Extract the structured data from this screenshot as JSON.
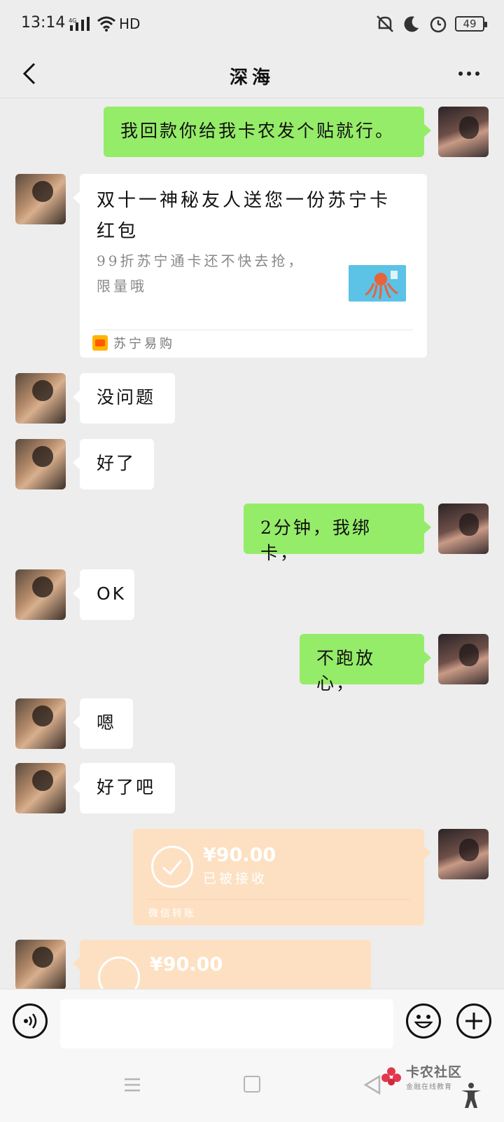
{
  "status_bar": {
    "time": "13:14",
    "network": "4G",
    "hd": "HD",
    "battery": "49"
  },
  "header": {
    "title": "深海"
  },
  "messages": [
    {
      "side": "right",
      "type": "text",
      "text": "我回款你给我卡农发个贴就行。"
    },
    {
      "side": "left",
      "type": "link",
      "title": "双十一神秘友人送您一份苏宁卡红包",
      "desc": "99折苏宁通卡还不快去抢，限量哦",
      "source": "苏宁易购"
    },
    {
      "side": "left",
      "type": "text",
      "text": "没问题"
    },
    {
      "side": "left",
      "type": "text",
      "text": "好了"
    },
    {
      "side": "right",
      "type": "text",
      "text": "2分钟，我绑卡，"
    },
    {
      "side": "left",
      "type": "text",
      "text": "OK"
    },
    {
      "side": "right",
      "type": "text",
      "text": "不跑放心，"
    },
    {
      "side": "left",
      "type": "text",
      "text": "嗯"
    },
    {
      "side": "left",
      "type": "text",
      "text": "好了吧"
    },
    {
      "side": "right",
      "type": "transfer",
      "amount": "¥90.00",
      "status": "已被接收",
      "footer": "微信转账"
    },
    {
      "side": "left",
      "type": "transfer",
      "amount": "¥90.00"
    }
  ],
  "input": {
    "placeholder": ""
  },
  "watermark": {
    "name": "卡农社区",
    "sub": "金融在线教育"
  },
  "colors": {
    "background": "#ededed",
    "sent_bubble": "#95ec69",
    "received_bubble": "#ffffff",
    "transfer_bubble": "#fde0c2"
  }
}
